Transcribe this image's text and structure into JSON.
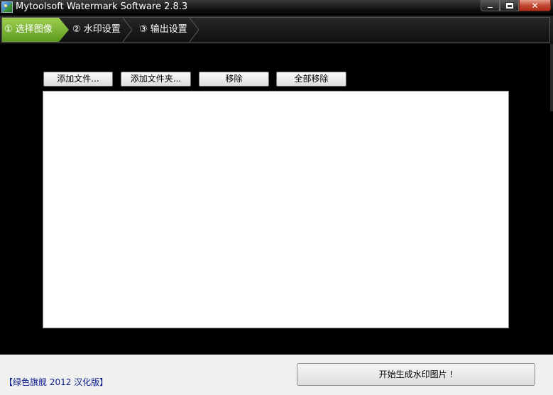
{
  "window": {
    "title": "Mytoolsoft Watermark Software 2.8.3",
    "icon": "app-landscape-icon"
  },
  "steps": [
    {
      "label": "① 选择图像",
      "active": true
    },
    {
      "label": "② 水印设置",
      "active": false
    },
    {
      "label": "③ 输出设置",
      "active": false
    }
  ],
  "toolbar": {
    "add_file": "添加文件...",
    "add_folder": "添加文件夹...",
    "remove": "移除",
    "remove_all": "全部移除"
  },
  "file_list": {
    "items": []
  },
  "footer": {
    "credit": "【绿色旗舰 2012 汉化版】",
    "start_button": "开始生成水印图片 !"
  },
  "colors": {
    "active_step": "#7fb83a",
    "credit_text": "#0a1a8c",
    "close_button": "#c24a34"
  }
}
